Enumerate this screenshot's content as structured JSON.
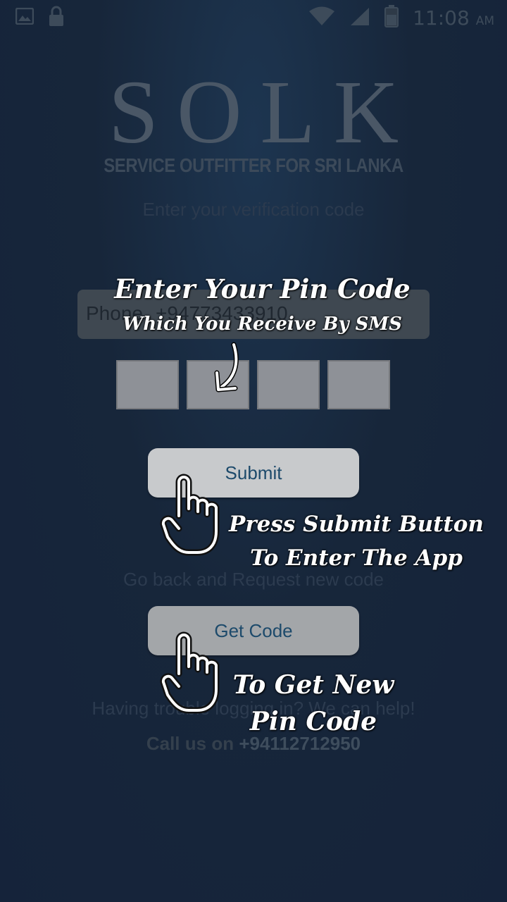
{
  "status": {
    "time": "11:08",
    "ampm": "AM"
  },
  "logo": {
    "word": "SOLK",
    "tagline": "SERVICE OUTFITTER FOR SRI LANKA"
  },
  "form": {
    "heading": "Enter your verification code",
    "phone_label": "Phone",
    "phone_value": "+94773433910",
    "submit_label": "Submit",
    "back_link": "Go back and Request new code",
    "get_code_label": "Get Code",
    "help_text": "Having trouble logging in? We can help!",
    "call_prefix": "Call us on",
    "call_number": "+94112712950"
  },
  "overlay": {
    "line1": "Enter Your Pin Code",
    "line2": "Which You Receive By SMS",
    "line3": "Press Submit Button",
    "line4": "To Enter The App",
    "line5": "To Get New",
    "line6": "Pin Code"
  }
}
